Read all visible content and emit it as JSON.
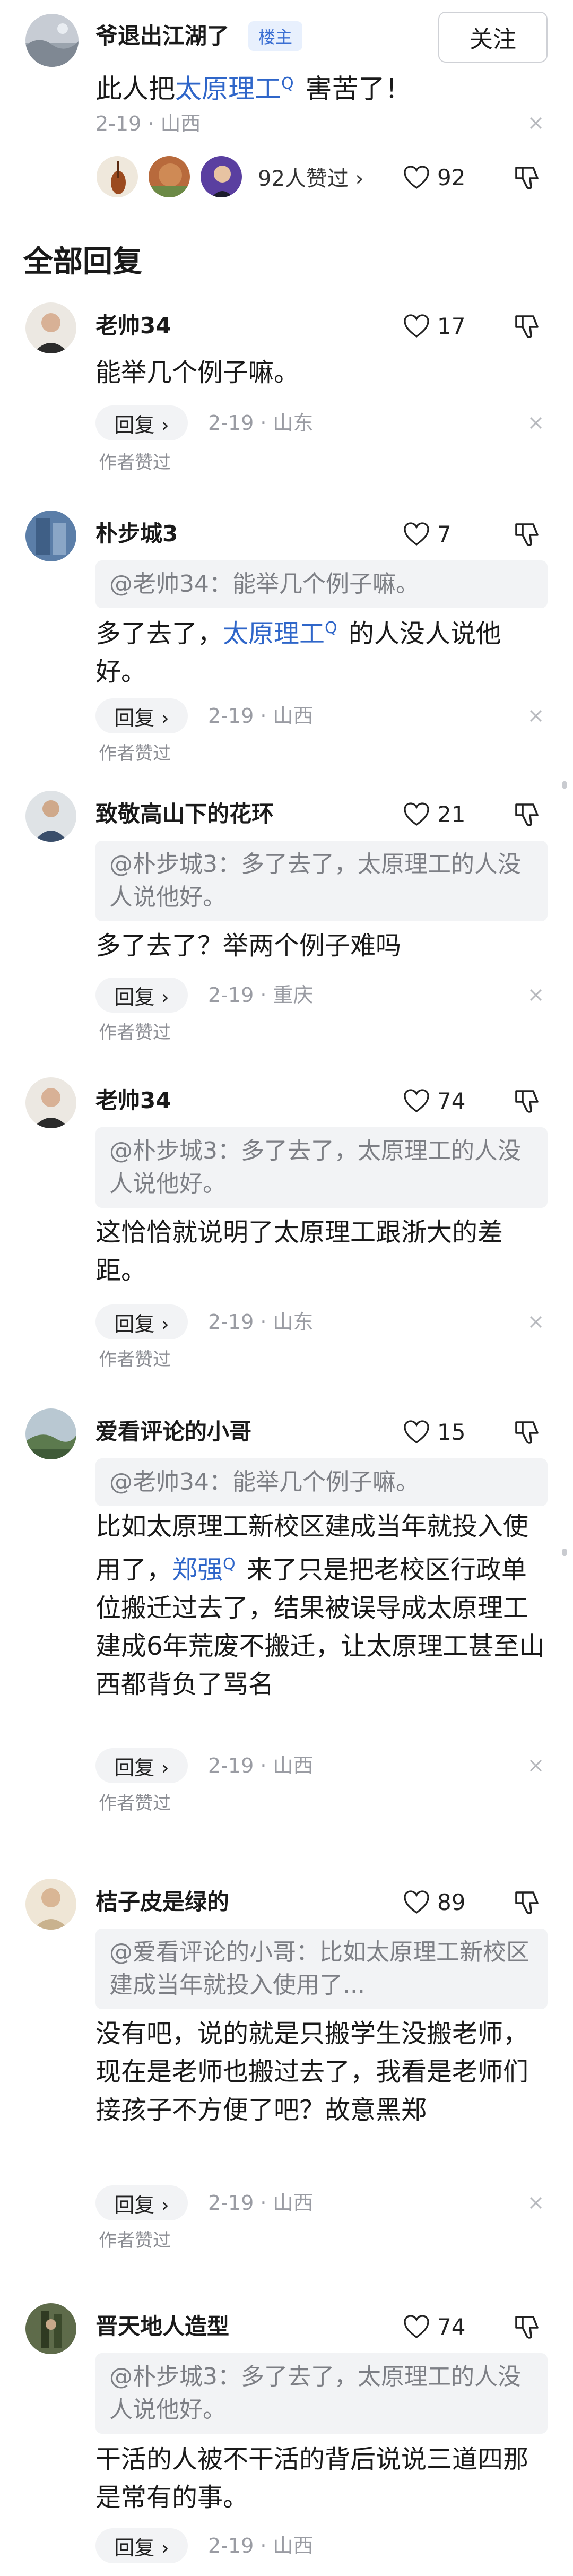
{
  "post": {
    "author": "爷退出江湖了",
    "badge": "楼主",
    "follow_label": "关注",
    "text_before": "此人把",
    "keyword": "太原理工",
    "keyword_icon": "Q",
    "text_after": " 害苦了！",
    "time_location": "2-19 · 山西",
    "likers_text": "92人赞过 ›",
    "like_count": "92"
  },
  "section_title": "全部回复",
  "reply_label": "回复 ›",
  "author_liked_label": "作者赞过",
  "keyword_icon": "Q",
  "comments": [
    {
      "username": "老帅34",
      "likes": "17",
      "quote": "",
      "text": "能举几个例子嘛。",
      "meta": "2-19 · 山东"
    },
    {
      "username": "朴步城3",
      "likes": "7",
      "quote": "@老帅34：能举几个例子嘛。",
      "text_before": "多了去了，",
      "keyword": "太原理工",
      "text_after": " 的人没人说他好。",
      "meta": "2-19 · 山西"
    },
    {
      "username": "致敬高山下的花环",
      "likes": "21",
      "quote": "@朴步城3：多了去了，太原理工的人没人说他好。",
      "text": "多了去了？举两个例子难吗",
      "meta": "2-19 · 重庆"
    },
    {
      "username": "老帅34",
      "likes": "74",
      "quote": "@朴步城3：多了去了，太原理工的人没人说他好。",
      "text": "这恰恰就说明了太原理工跟浙大的差距。",
      "meta": "2-19 · 山东"
    },
    {
      "username": "爱看评论的小哥",
      "likes": "15",
      "quote": "@老帅34：能举几个例子嘛。",
      "text_before": "比如太原理工新校区建成当年就投入使用了，",
      "keyword": "郑强",
      "text_after": " 来了只是把老校区行政单位搬迁过去了，结果被误导成太原理工建成6年荒废不搬迁，让太原理工甚至山西都背负了骂名",
      "meta": "2-19 · 山西"
    },
    {
      "username": "桔子皮是绿的",
      "likes": "89",
      "quote": "@爱看评论的小哥：比如太原理工新校区建成当年就投入使用了...",
      "text": "没有吧，说的就是只搬学生没搬老师，现在是老师也搬过去了，我看是老师们接孩子不方便了吧？故意黑郑",
      "meta": "2-19 · 山西"
    },
    {
      "username": "晋天地人造型",
      "likes": "74",
      "quote": "@朴步城3：多了去了，太原理工的人没人说他好。",
      "text": "干活的人被不干活的背后说说三道四那是常有的事。",
      "meta": "2-19 · 山西"
    }
  ],
  "colors": {
    "keyword": "#2f66c9",
    "quote_bg": "#f2f3f5",
    "meta_gray": "#9a9ca3",
    "badge_bg": "#e8f0fd"
  }
}
